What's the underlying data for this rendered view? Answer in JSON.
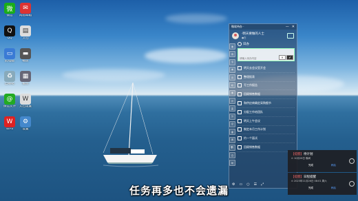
{
  "desktop": {
    "icons": [
      {
        "label": "微信",
        "glyph": "微",
        "color": "#1aad19",
        "icon": "wechat-icon"
      },
      {
        "label": "网易邮箱",
        "glyph": "✉",
        "color": "#d33",
        "icon": "mail-icon"
      },
      {
        "label": "QQ",
        "glyph": "Q",
        "color": "#111",
        "icon": "qq-icon"
      },
      {
        "label": "文档",
        "glyph": "▤",
        "color": "#ddd",
        "icon": "document-icon"
      },
      {
        "label": "此电脑",
        "glyph": "▭",
        "color": "#3a7bd5",
        "icon": "computer-icon"
      },
      {
        "label": "磁盘",
        "glyph": "▬",
        "color": "#555",
        "icon": "disk-icon"
      },
      {
        "label": "回收站",
        "glyph": "♻",
        "color": "#8ab",
        "icon": "recycle-bin-icon"
      },
      {
        "label": "截图",
        "glyph": "▦",
        "color": "#667",
        "icon": "screenshot-icon"
      },
      {
        "label": "微信文件",
        "glyph": "@",
        "color": "#2a2",
        "icon": "browser-icon"
      },
      {
        "label": "文档设置",
        "glyph": "W",
        "color": "#ddd",
        "icon": "word-icon"
      },
      {
        "label": "WPS",
        "glyph": "W",
        "color": "#d22",
        "icon": "wps-icon"
      },
      {
        "label": "设置",
        "glyph": "⚙",
        "color": "#48c",
        "icon": "settings-icon"
      }
    ]
  },
  "todo": {
    "window_title": "微软待办 ·",
    "controls": [
      "—",
      "✕"
    ],
    "profile_name": "·明天要做的人士",
    "profile_sub": "●在",
    "list_name": "日办",
    "input_placeholder": "请输入待办内容",
    "btn_cancel": "✕",
    "btn_ok": "✔",
    "side_tabs": [
      "收",
      "待",
      "今",
      "本",
      "月",
      "标",
      "重",
      "计",
      "完",
      "分",
      "记",
      "备",
      "周",
      "习",
      "日",
      "时"
    ],
    "tasks": [
      "明天去会议室开会",
      "整理报表",
      "写工作报告",
      "回顾销售数据",
      "和供应商确定采购细节",
      "分配工作给团队",
      "明天上午会议",
      "制定本月工作计划",
      "约一个面试",
      "回顾销售数据"
    ],
    "add_symbol": "+",
    "footer_icons": [
      "⚙",
      "▭",
      "○",
      "☰",
      "⤢"
    ]
  },
  "notifications": [
    {
      "tag": "【提醒】",
      "title": "待计划",
      "time": "⊙ 10月26日 晚间",
      "btn_left": "完成",
      "btn_right": "稍后"
    },
    {
      "tag": "【提醒】",
      "title": "日程提醒",
      "time": "⊙ 2023年11月26日 08:01 周六",
      "btn_left": "完成",
      "btn_right": "稍后"
    }
  ],
  "subtitle": "任务再多也不会遗漏"
}
